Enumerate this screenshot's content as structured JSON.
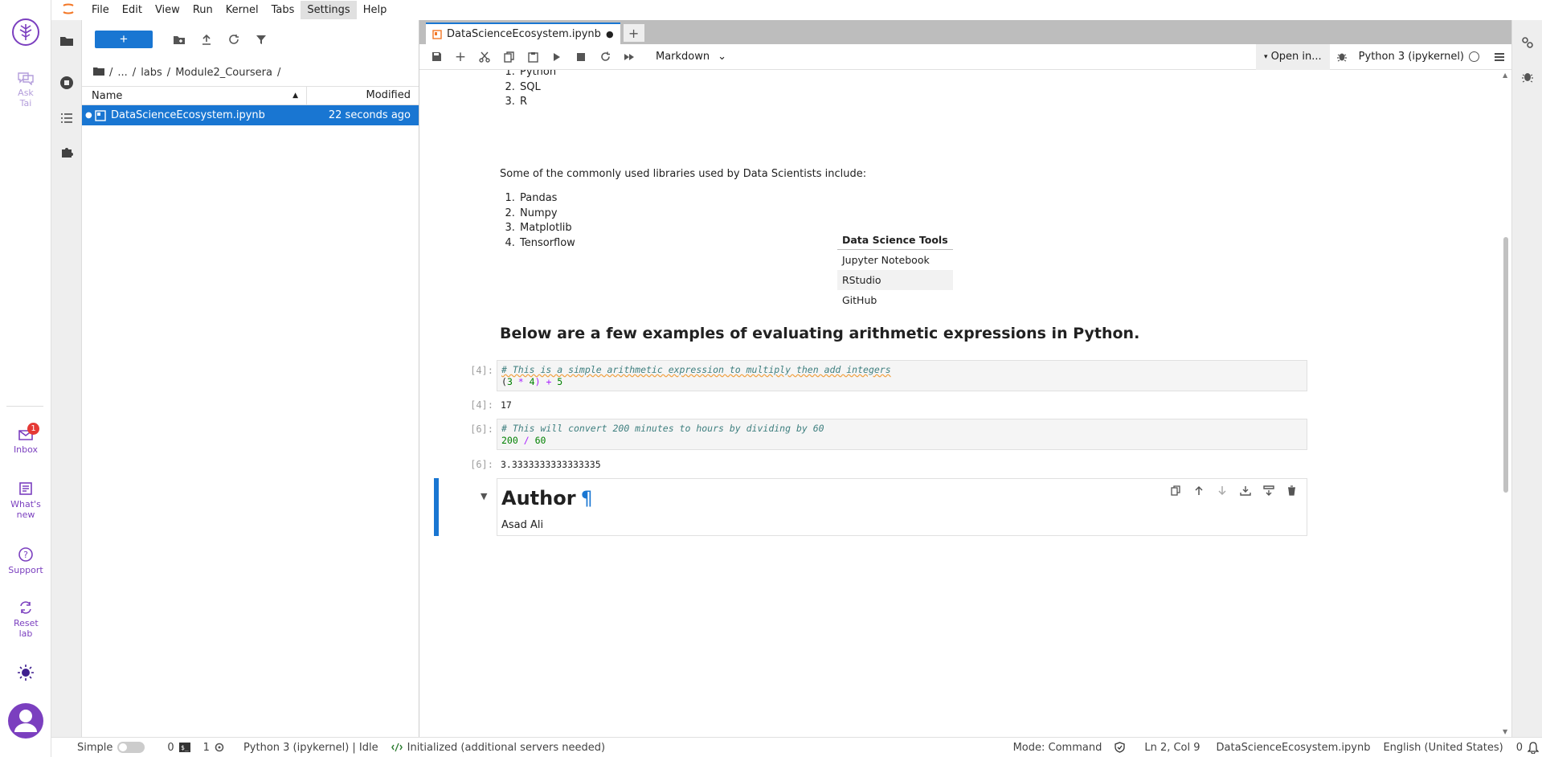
{
  "rail": {
    "ask_tai": "Ask Tai",
    "inbox": "Inbox",
    "inbox_badge": "1",
    "whats_new": "What's new",
    "support": "Support",
    "reset_lab": "Reset lab"
  },
  "menu": [
    "File",
    "Edit",
    "View",
    "Run",
    "Kernel",
    "Tabs",
    "Settings",
    "Help"
  ],
  "filebrowser": {
    "new_label": "+",
    "breadcrumbs": [
      "...",
      "labs",
      "Module2_Coursera"
    ],
    "col_name": "Name",
    "col_modified": "Modified",
    "files": [
      {
        "name": "DataScienceEcosystem.ipynb",
        "modified": "22 seconds ago"
      }
    ]
  },
  "notebook": {
    "tab_title": "DataScienceEcosystem.ipynb",
    "cell_type": "Markdown",
    "open_in": "Open in...",
    "kernel": "Python 3 (ipykernel)",
    "languages": [
      "Python",
      "SQL",
      "R"
    ],
    "libraries_intro": "Some of the commonly used libraries used by Data Scientists include:",
    "libraries": [
      "Pandas",
      "Numpy",
      "Matplotlib",
      "Tensorflow"
    ],
    "table_header": "Data Science Tools",
    "tools": [
      "Jupyter Notebook",
      "RStudio",
      "GitHub"
    ],
    "arith_heading": "Below are a few examples of evaluating arithmetic expressions in Python.",
    "cells": [
      {
        "prompt": "[4]:",
        "comment": "# This is a simple arithmetic expression to multiply then add integers",
        "code": [
          "(",
          "3",
          " * ",
          "4",
          ") + ",
          "5"
        ],
        "out_prompt": "[4]:",
        "output": "17"
      },
      {
        "prompt": "[6]:",
        "comment": "# This will convert 200 minutes to hours by dividing by 60",
        "code": [
          "200",
          " / ",
          "60"
        ],
        "out_prompt": "[6]:",
        "output": "3.3333333333333335"
      }
    ],
    "author_heading": "Author",
    "pilcrow": "¶",
    "author_name": "Asad Ali"
  },
  "statusbar": {
    "simple": "Simple",
    "terminals": "0",
    "kernels": "1",
    "kernel_status": "Python 3 (ipykernel) | Idle",
    "lsp": "Initialized (additional servers needed)",
    "mode": "Mode: Command",
    "position": "Ln 2, Col 9",
    "filename": "DataScienceEcosystem.ipynb",
    "language": "English (United States)",
    "notifications": "0"
  },
  "colors": {
    "accent": "#1976d2",
    "rail_purple": "#7b3fbf",
    "jupyter_orange": "#f37726"
  }
}
